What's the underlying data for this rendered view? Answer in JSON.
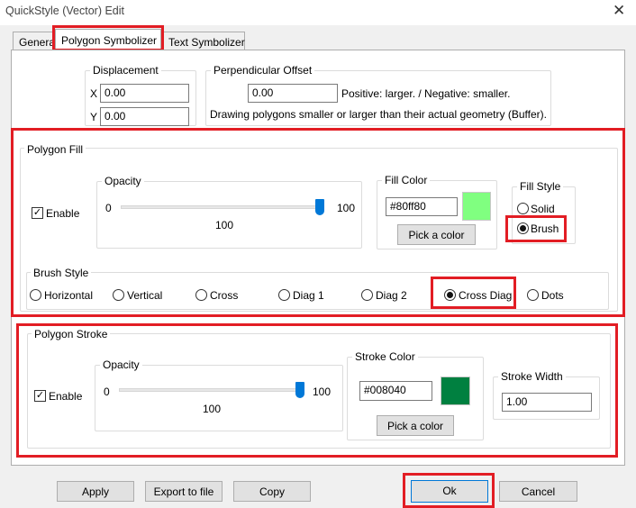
{
  "window": {
    "title": "QuickStyle (Vector) Edit",
    "close_glyph": "✕"
  },
  "tabs": [
    {
      "label": "General"
    },
    {
      "label": "Polygon Symbolizer"
    },
    {
      "label": "Text Symbolizer"
    }
  ],
  "displacement": {
    "title": "Displacement",
    "x_label": "X",
    "x_value": "0.00",
    "y_label": "Y",
    "y_value": "0.00"
  },
  "perpendicular_offset": {
    "title": "Perpendicular Offset",
    "value": "0.00",
    "hint": "Positive: larger. / Negative: smaller.",
    "description": "Drawing polygons smaller or larger than their actual geometry (Buffer)."
  },
  "polygon_fill": {
    "title": "Polygon Fill",
    "enable_label": "Enable",
    "enable_checked": true,
    "opacity": {
      "title": "Opacity",
      "min": "0",
      "max": "100",
      "value": "100",
      "level": 100
    },
    "fill_color": {
      "title": "Fill Color",
      "value": "#80ff80",
      "swatch": "#80ff80",
      "pick_label": "Pick a color"
    },
    "fill_style": {
      "title": "Fill Style",
      "options": [
        "Solid",
        "Brush"
      ],
      "selected": "Brush"
    },
    "brush_style": {
      "title": "Brush Style",
      "options": [
        "Horizontal",
        "Vertical",
        "Cross",
        "Diag 1",
        "Diag 2",
        "Cross Diag",
        "Dots"
      ],
      "selected": "Cross Diag"
    }
  },
  "polygon_stroke": {
    "title": "Polygon Stroke",
    "enable_label": "Enable",
    "enable_checked": true,
    "opacity": {
      "title": "Opacity",
      "min": "0",
      "max": "100",
      "value": "100",
      "level": 100
    },
    "stroke_color": {
      "title": "Stroke Color",
      "value": "#008040",
      "swatch": "#008040",
      "pick_label": "Pick a color"
    },
    "stroke_width": {
      "title": "Stroke Width",
      "value": "1.00"
    }
  },
  "footer": {
    "apply": "Apply",
    "export": "Export to file",
    "copy": "Copy",
    "ok": "Ok",
    "cancel": "Cancel"
  },
  "colors": {
    "highlight": "#e21d24",
    "slider_thumb": "#0078d7"
  }
}
